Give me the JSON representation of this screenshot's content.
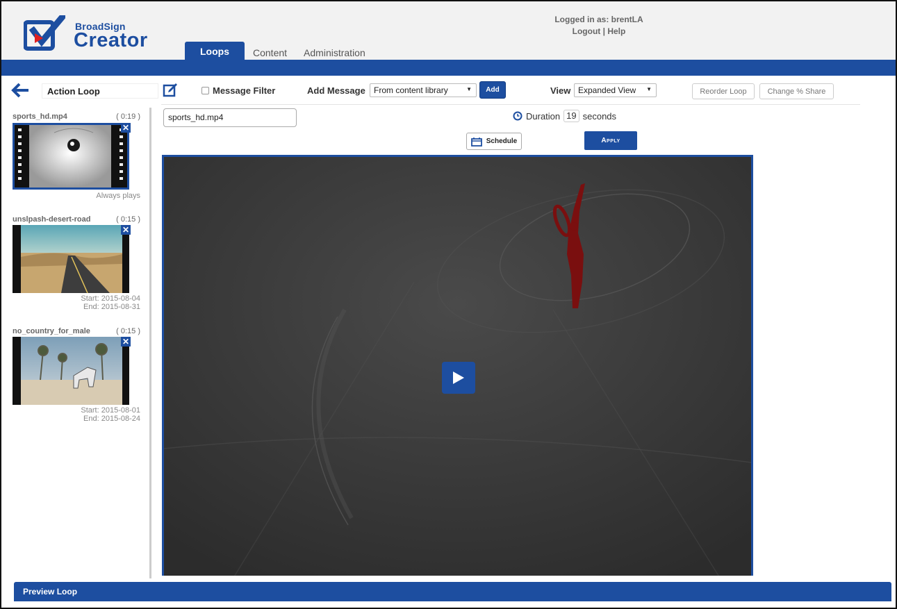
{
  "brand": {
    "top": "BroadSign",
    "main": "Creator"
  },
  "session": {
    "logged_in_as": "Logged in as: brentLA",
    "logout": "Logout",
    "separator": " | ",
    "help": "Help"
  },
  "nav": {
    "tabs": [
      {
        "label": "Loops",
        "active": true
      },
      {
        "label": "Content"
      },
      {
        "label": "Administration"
      }
    ]
  },
  "toolbar": {
    "loop_name": "Action Loop",
    "message_filter": "Message Filter",
    "add_message_label": "Add Message",
    "add_message_source": "From content library",
    "add_button": "Add",
    "view_label": "View",
    "view_value": "Expanded View",
    "reorder_button": "Reorder Loop",
    "share_button": "Change % Share"
  },
  "sidebar": {
    "items": [
      {
        "name": "sports_hd.mp4",
        "duration": "( 0:19 )",
        "footer1": "Always plays",
        "footer2": ""
      },
      {
        "name": "unslpash-desert-road",
        "duration": "( 0:15 )",
        "footer1": "Start: 2015-08-04",
        "footer2": "End: 2015-08-31"
      },
      {
        "name": "no_country_for_male",
        "duration": "( 0:15 )",
        "footer1": "Start: 2015-08-01",
        "footer2": "End: 2015-08-24"
      }
    ]
  },
  "editor": {
    "file_name": "sports_hd.mp4",
    "duration_label": "Duration",
    "duration_value": "19",
    "duration_unit": "seconds",
    "schedule_button": "Schedule",
    "apply_button": "Apply"
  },
  "footer": {
    "preview_label": "Preview Loop"
  },
  "colors": {
    "brand_blue": "#1d4ea0"
  }
}
